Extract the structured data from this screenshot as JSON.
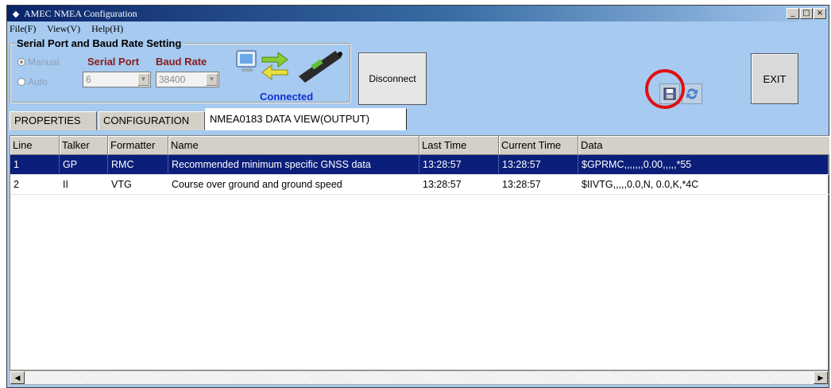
{
  "window": {
    "title": "AMEC NMEA Configuration",
    "controls": [
      "_",
      "□",
      "×"
    ]
  },
  "menu": [
    "File(F)",
    "View(V)",
    "Help(H)"
  ],
  "serial": {
    "group_title": "Serial Port and Baud Rate Setting",
    "radio_manual": "Manual",
    "radio_auto": "Auto",
    "serial_port_label": "Serial Port",
    "baud_rate_label": "Baud Rate",
    "serial_port_value": "6",
    "baud_rate_value": "38400",
    "status": "Connected"
  },
  "buttons": {
    "disconnect": "Disconnect",
    "exit": "EXIT"
  },
  "tabs": [
    "PROPERTIES",
    "CONFIGURATION",
    "NMEA0183 DATA VIEW(OUTPUT)"
  ],
  "table": {
    "columns": [
      "Line",
      "Talker",
      "Formatter",
      "Name",
      "Last Time",
      "Current Time",
      "Data"
    ],
    "rows": [
      [
        "1",
        "GP",
        "RMC",
        "Recommended minimum specific GNSS data",
        "13:28:57",
        "13:28:57",
        "$GPRMC,,,,,,,0.00,,,,,*55"
      ],
      [
        "2",
        "II",
        "VTG",
        "Course over ground and ground speed",
        "13:28:57",
        "13:28:57",
        "$IIVTG,,,,,0.0,N, 0.0,K,*4C"
      ]
    ]
  },
  "colors": {
    "background": "#a6caf0",
    "selection": "#0a1e7a",
    "highlight_circle": "#e01010",
    "port_label": "#8b1a1a",
    "connected": "#1030d0"
  }
}
